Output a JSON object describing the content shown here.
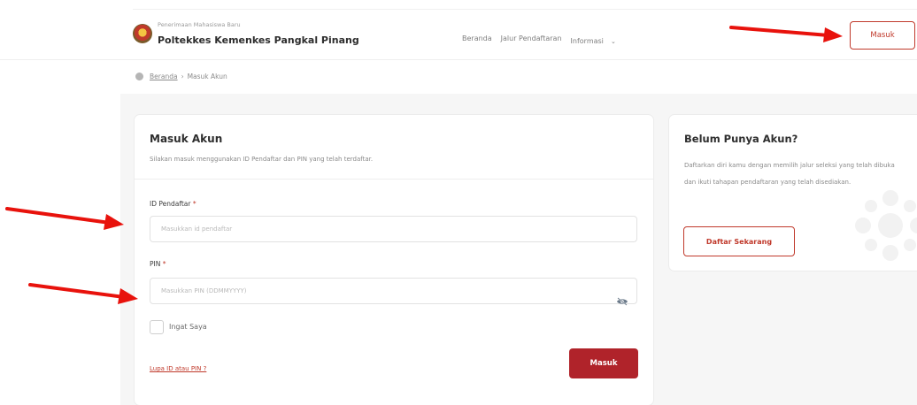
{
  "header": {
    "brand_subtitle": "Penerimaan Mahasiswa Baru",
    "brand_name": "Poltekkes Kemenkes Pangkal Pinang",
    "nav": [
      {
        "label": "Beranda"
      },
      {
        "label": "Jalur Pendaftaran"
      },
      {
        "label": "Informasi"
      }
    ],
    "login_button": "Masuk"
  },
  "breadcrumb": {
    "home": "Beranda",
    "separator": "›",
    "current": "Masuk Akun"
  },
  "login_card": {
    "title": "Masuk Akun",
    "subtitle": "Silakan masuk menggunakan ID Pendaftar dan PIN yang telah terdaftar.",
    "id_label": "ID Pendaftar",
    "id_placeholder": "Masukkan id pendaftar",
    "id_value": "",
    "pin_label": "PIN",
    "pin_placeholder": "Masukkan PIN (DDMMYYYY)",
    "pin_value": "",
    "required_marker": "*",
    "remember_label": "Ingat Saya",
    "remember_checked": false,
    "forgot_link": "Lupa ID atau PIN ?",
    "submit_button": "Masuk"
  },
  "side_card": {
    "title": "Belum Punya Akun?",
    "text": "Daftarkan diri kamu dengan memilih jalur seleksi yang telah dibuka dan ikuti tahapan pendaftaran yang telah disediakan.",
    "button": "Daftar Sekarang"
  },
  "icons": {
    "logo": "institution-logo",
    "home": "home-icon",
    "dropdown": "chevron-down-icon",
    "password_toggle": "eye-slash-icon"
  },
  "colors": {
    "accent": "#c0392b",
    "primary_button": "#b0232a",
    "annotation_arrow": "#e8120c"
  }
}
